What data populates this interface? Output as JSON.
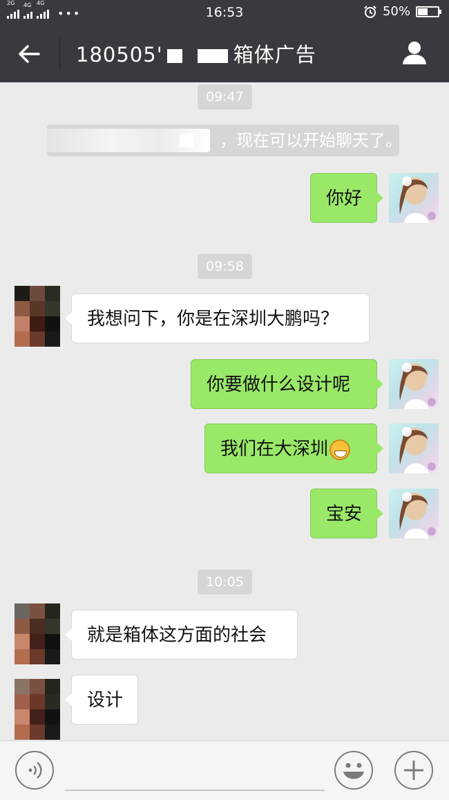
{
  "status_bar": {
    "network_1": "2G",
    "network_2": "4G",
    "network_3": "4G",
    "overflow": "•••",
    "time": "16:53",
    "alarm_icon": "alarm-clock-icon",
    "battery_percent": "50%",
    "battery_level": 0.5
  },
  "header": {
    "back_icon": "arrow-left-icon",
    "title_prefix": "180505'",
    "title_suffix": "箱体广告",
    "profile_icon": "person-icon",
    "bg_color": "#393a3f"
  },
  "chat": {
    "system_message": "，现在可以开始聊天了。",
    "timestamps": [
      "09:47",
      "09:58",
      "10:05"
    ],
    "messages": [
      {
        "direction": "out",
        "text": "你好"
      },
      {
        "direction": "in",
        "text": "我想问下，你是在深圳大鹏吗？"
      },
      {
        "direction": "out",
        "text": "你要做什么设计呢"
      },
      {
        "direction": "out",
        "text": "我们在大深圳",
        "emoji": "grinning-face-icon"
      },
      {
        "direction": "out",
        "text": "宝安"
      },
      {
        "direction": "in",
        "text": "就是箱体这方面的社会"
      },
      {
        "direction": "in",
        "text": "设计"
      }
    ],
    "outgoing_bubble_color": "#9ae868",
    "incoming_bubble_color": "#ffffff"
  },
  "input_bar": {
    "voice_icon": "voice-icon",
    "emoji_icon": "smiley-icon",
    "more_icon": "plus-icon"
  }
}
